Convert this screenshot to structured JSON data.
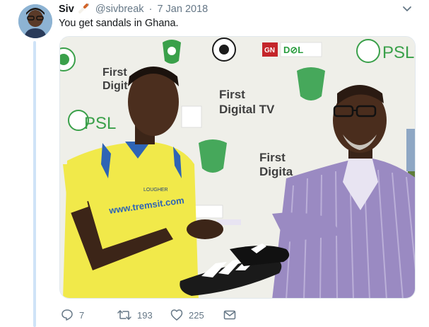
{
  "tweet": {
    "author_name": "Siv",
    "author_handle": "@sivbreak",
    "separator": "·",
    "date": "7 Jan 2018",
    "text": "You get sandals in Ghana."
  },
  "photo": {
    "banner_texts": {
      "first_digital_1": "First",
      "first_digital_2": "Digit",
      "first_digital_tv_1": "First",
      "first_digital_tv_2": "Digital TV",
      "first_digital_3": "First",
      "first_digital_4": "Digita",
      "psl_1": "PSL",
      "psl_2": "PSL",
      "gn": "GN",
      "dol": "D⊘L",
      "jersey_url": "www.tremsit.com",
      "jersey_brand": "LOUGHER"
    }
  },
  "actions": {
    "reply_count": "7",
    "retweet_count": "193",
    "like_count": "225"
  },
  "icons": {
    "avatar": "user-avatar",
    "emoji": "cigarette-emoji",
    "menu": "chevron-down-icon",
    "reply": "reply-icon",
    "retweet": "retweet-icon",
    "like": "heart-icon",
    "dm": "envelope-icon"
  },
  "colors": {
    "thread_line": "#cfe3f7",
    "secondary_text": "#657786",
    "jersey_yellow": "#f1e94a",
    "banner_green": "#3aa04a"
  }
}
